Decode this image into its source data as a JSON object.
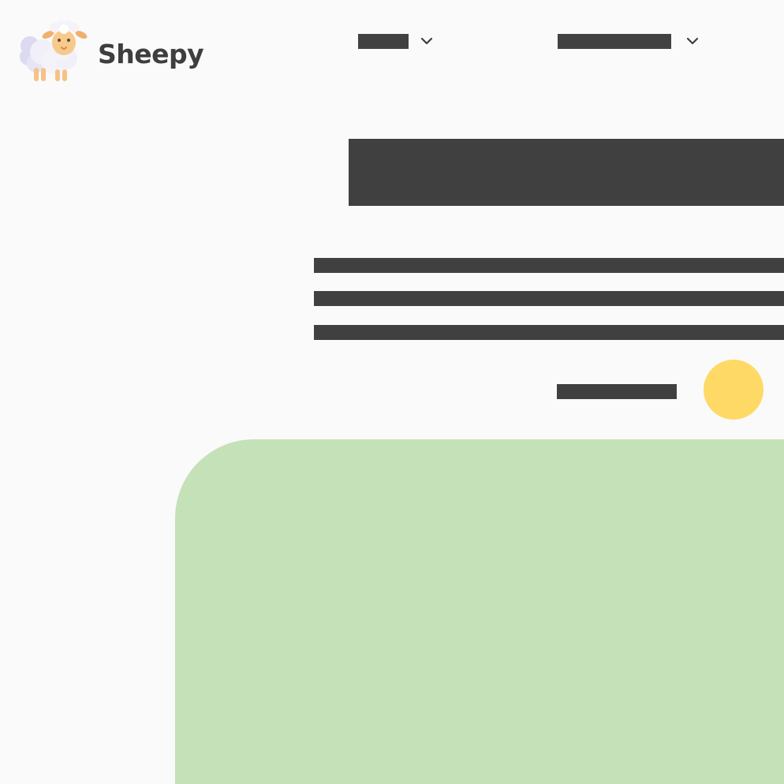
{
  "header": {
    "brand_name": "Sheepy",
    "logo_icon": "sheep-icon",
    "nav": [
      {
        "label": "",
        "icon": "chevron-down-icon"
      },
      {
        "label": "",
        "icon": "chevron-down-icon"
      }
    ]
  },
  "hero": {
    "title": "",
    "lines": [
      "",
      "",
      ""
    ],
    "cta_label": "",
    "cta_icon": "yellow-circle"
  },
  "colors": {
    "background": "#fafafa",
    "text": "#404040",
    "accent_yellow": "#ffd966",
    "panel_green": "#c5e1b7"
  }
}
